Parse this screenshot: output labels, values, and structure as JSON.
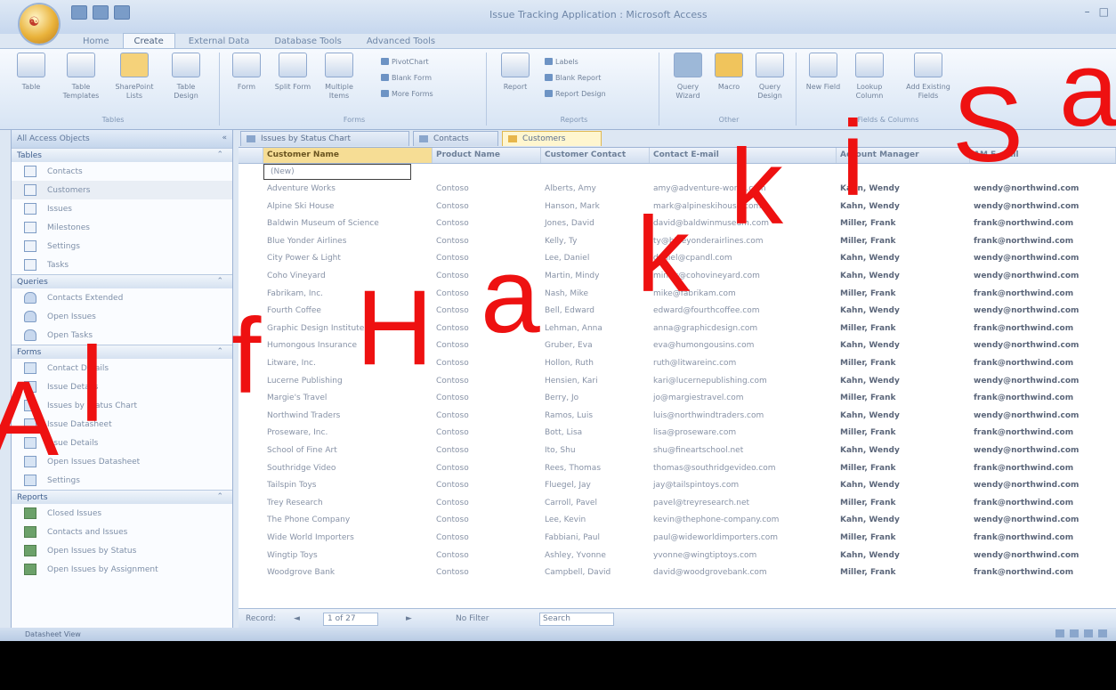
{
  "title_bar": {
    "office_button_glyph": "☯",
    "title": "Issue Tracking Application : Microsoft Access"
  },
  "ribbon": {
    "tabs": [
      "Home",
      "Create",
      "External Data",
      "Database Tools",
      "Advanced Tools"
    ],
    "active_tab": "Create",
    "groups": [
      {
        "name": "Tables",
        "buttons": [
          "Table",
          "Table Templates",
          "SharePoint Lists",
          "Table Design"
        ]
      },
      {
        "name": "Forms",
        "buttons": [
          "Form",
          "Split Form",
          "Multiple Items"
        ],
        "small": [
          "PivotChart",
          "Blank Form",
          "More Forms"
        ]
      },
      {
        "name": "Reports",
        "buttons": [
          "Report"
        ],
        "small": [
          "Labels",
          "Blank Report",
          "Report Design"
        ]
      },
      {
        "name": "Other",
        "buttons": [
          "Query Wizard",
          "Macro",
          "Query Design"
        ]
      },
      {
        "name": "Fields & Columns",
        "buttons": [
          "New Field",
          "Lookup Column",
          "Add Existing Fields"
        ]
      }
    ]
  },
  "nav_pane": {
    "header": "All Access Objects",
    "groups": [
      {
        "name": "Tables",
        "items": [
          "Contacts",
          "Customers",
          "Issues",
          "Milestones",
          "Settings",
          "Tasks"
        ],
        "selected": "Customers"
      },
      {
        "name": "Queries",
        "items": [
          "Contacts Extended",
          "Open Issues",
          "Open Tasks"
        ]
      },
      {
        "name": "Forms",
        "items": [
          "Contact Details",
          "Issue Details",
          "Issues by Status Chart",
          "Issue Datasheet",
          "Issue Details",
          "Open Issues Datasheet",
          "Settings"
        ]
      },
      {
        "name": "Reports",
        "items": [
          "Closed Issues",
          "Contacts and Issues",
          "Open Issues by Status",
          "Open Issues by Assignment"
        ]
      }
    ]
  },
  "doc_tabs": [
    {
      "label": "Issues by Status Chart",
      "active": false
    },
    {
      "label": "Contacts",
      "active": false
    },
    {
      "label": "Customers",
      "active": true
    }
  ],
  "grid": {
    "columns": [
      "Customer Name",
      "Product Name",
      "Customer Contact",
      "Contact E-mail",
      "Account Manager",
      "AM E-mail"
    ],
    "new_row_placeholder": "(New)",
    "rows": [
      [
        "Adventure Works",
        "Contoso",
        "Alberts, Amy",
        "amy@adventure-works.com",
        "Kahn, Wendy",
        "wendy@northwind.com"
      ],
      [
        "Alpine Ski House",
        "Contoso",
        "Hanson, Mark",
        "mark@alpineskihouse.com",
        "Kahn, Wendy",
        "wendy@northwind.com"
      ],
      [
        "Baldwin Museum of Science",
        "Contoso",
        "Jones, David",
        "david@baldwinmuseum.com",
        "Miller, Frank",
        "frank@northwind.com"
      ],
      [
        "Blue Yonder Airlines",
        "Contoso",
        "Kelly, Ty",
        "ty@blueyonderairlines.com",
        "Miller, Frank",
        "frank@northwind.com"
      ],
      [
        "City Power & Light",
        "Contoso",
        "Lee, Daniel",
        "daniel@cpandl.com",
        "Kahn, Wendy",
        "wendy@northwind.com"
      ],
      [
        "Coho Vineyard",
        "Contoso",
        "Martin, Mindy",
        "mindy@cohovineyard.com",
        "Kahn, Wendy",
        "wendy@northwind.com"
      ],
      [
        "Fabrikam, Inc.",
        "Contoso",
        "Nash, Mike",
        "mike@fabrikam.com",
        "Miller, Frank",
        "frank@northwind.com"
      ],
      [
        "Fourth Coffee",
        "Contoso",
        "Bell, Edward",
        "edward@fourthcoffee.com",
        "Kahn, Wendy",
        "wendy@northwind.com"
      ],
      [
        "Graphic Design Institute",
        "Contoso",
        "Lehman, Anna",
        "anna@graphicdesign.com",
        "Miller, Frank",
        "frank@northwind.com"
      ],
      [
        "Humongous Insurance",
        "Contoso",
        "Gruber, Eva",
        "eva@humongousins.com",
        "Kahn, Wendy",
        "wendy@northwind.com"
      ],
      [
        "Litware, Inc.",
        "Contoso",
        "Hollon, Ruth",
        "ruth@litwareinc.com",
        "Miller, Frank",
        "frank@northwind.com"
      ],
      [
        "Lucerne Publishing",
        "Contoso",
        "Hensien, Kari",
        "kari@lucernepublishing.com",
        "Kahn, Wendy",
        "wendy@northwind.com"
      ],
      [
        "Margie's Travel",
        "Contoso",
        "Berry, Jo",
        "jo@margiestravel.com",
        "Miller, Frank",
        "frank@northwind.com"
      ],
      [
        "Northwind Traders",
        "Contoso",
        "Ramos, Luis",
        "luis@northwindtraders.com",
        "Kahn, Wendy",
        "wendy@northwind.com"
      ],
      [
        "Proseware, Inc.",
        "Contoso",
        "Bott, Lisa",
        "lisa@proseware.com",
        "Miller, Frank",
        "frank@northwind.com"
      ],
      [
        "School of Fine Art",
        "Contoso",
        "Ito, Shu",
        "shu@fineartschool.net",
        "Kahn, Wendy",
        "wendy@northwind.com"
      ],
      [
        "Southridge Video",
        "Contoso",
        "Rees, Thomas",
        "thomas@southridgevideo.com",
        "Miller, Frank",
        "frank@northwind.com"
      ],
      [
        "Tailspin Toys",
        "Contoso",
        "Fluegel, Jay",
        "jay@tailspintoys.com",
        "Kahn, Wendy",
        "wendy@northwind.com"
      ],
      [
        "Trey Research",
        "Contoso",
        "Carroll, Pavel",
        "pavel@treyresearch.net",
        "Miller, Frank",
        "frank@northwind.com"
      ],
      [
        "The Phone Company",
        "Contoso",
        "Lee, Kevin",
        "kevin@thephone-company.com",
        "Kahn, Wendy",
        "wendy@northwind.com"
      ],
      [
        "Wide World Importers",
        "Contoso",
        "Fabbiani, Paul",
        "paul@wideworldimporters.com",
        "Miller, Frank",
        "frank@northwind.com"
      ],
      [
        "Wingtip Toys",
        "Contoso",
        "Ashley, Yvonne",
        "yvonne@wingtiptoys.com",
        "Kahn, Wendy",
        "wendy@northwind.com"
      ],
      [
        "Woodgrove Bank",
        "Contoso",
        "Campbell, David",
        "david@woodgrovebank.com",
        "Miller, Frank",
        "frank@northwind.com"
      ]
    ]
  },
  "record_nav": {
    "label": "Record:",
    "position": "1 of 27",
    "filter": "No Filter",
    "search": "Search"
  },
  "status_bar": {
    "text": "Datasheet View"
  },
  "watermark": {
    "text": "Alf Hakki Sakl",
    "color": "#ee1111"
  }
}
